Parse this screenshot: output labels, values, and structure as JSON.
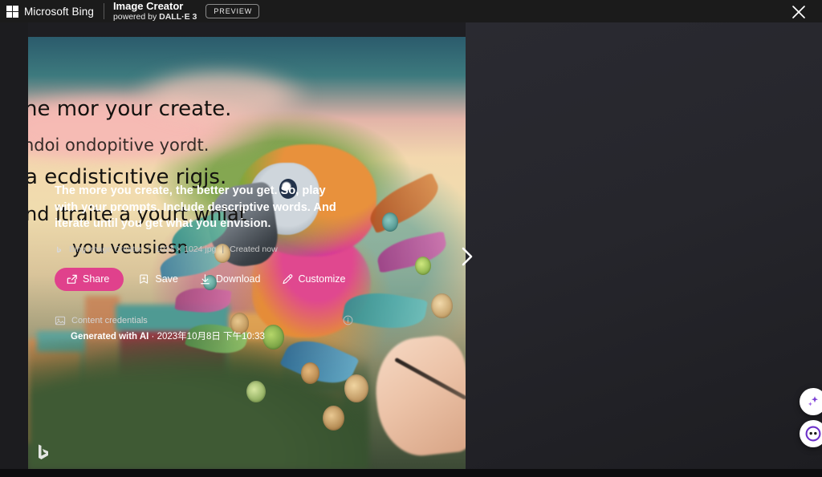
{
  "topbar": {
    "ms_logo_icon": "microsoft-squares-icon",
    "brand": "Microsoft Bing",
    "product_title": "Image Creator",
    "product_sub_prefix": "powered by ",
    "product_sub_model": "DALL·E 3",
    "preview_badge": "PREVIEW",
    "close_icon": "close-icon"
  },
  "viewer": {
    "next_icon": "chevron-right-icon",
    "watermark_icon": "bing-logo-icon",
    "image_alt_lines": [
      "he mor your create.",
      "ndoi ondopitive yordt.",
      "a ecdisticıtive rigjs.",
      "nd  itraite a yourt whlat",
      "you veusiesn"
    ]
  },
  "detail": {
    "prompt": "The more you create, the better you get. So, play with your prompts. Include descriptive words. And iterate until you get what you envision.",
    "meta": {
      "source_icon": "bing-logo-icon",
      "source": "Bing Image Creator",
      "dimensions": "1024 × 1024 jpg",
      "created": "Created now",
      "separator": "|"
    },
    "actions": [
      {
        "id": "share",
        "label": "Share",
        "icon": "share-icon",
        "primary": true
      },
      {
        "id": "save",
        "label": "Save",
        "icon": "save-icon",
        "primary": false
      },
      {
        "id": "download",
        "label": "Download",
        "icon": "download-icon",
        "primary": false
      },
      {
        "id": "customize",
        "label": "Customize",
        "icon": "customize-icon",
        "primary": false
      }
    ],
    "credentials": {
      "icon": "content-credentials-icon",
      "title": "Content credentials",
      "generated_label": "Generated with AI",
      "dot": "·",
      "timestamp": "2023年10月8日 下午10:33",
      "info_icon": "info-circle-icon"
    }
  },
  "fabs": [
    {
      "id": "sparkle",
      "icon": "sparkle-icon"
    },
    {
      "id": "copilot",
      "icon": "copilot-face-icon"
    }
  ],
  "colors": {
    "accent_pink": "#e0418c",
    "topbar_bg": "#1b1b1b",
    "panel_bg": "#2a2a31",
    "stage_bg": "#1e1e22",
    "text_primary": "#ffffff",
    "text_muted": "#c9c9c9"
  }
}
